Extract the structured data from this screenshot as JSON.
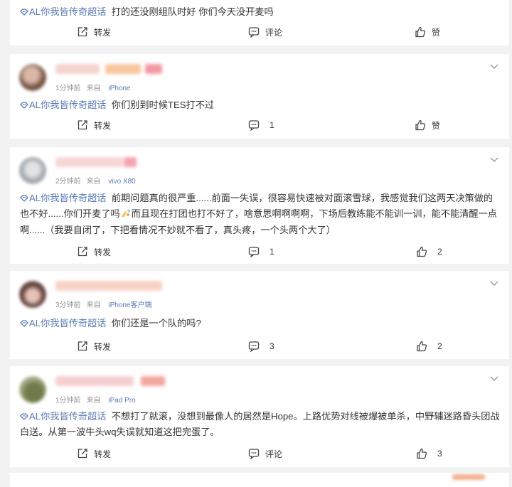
{
  "topic_label": "AL你我皆传奇超话",
  "action_labels": {
    "share": "转发",
    "comment": "评论",
    "like": "赞"
  },
  "posts": [
    {
      "user": {
        "time": "",
        "source_prefix": "",
        "source": ""
      },
      "text": "打的还没刚组队时好 你们今天没开麦吗",
      "actions": {
        "share": "转发",
        "comment": "评论",
        "like": "赞"
      }
    },
    {
      "user": {
        "time": "1分钟前",
        "source_prefix": "来自",
        "source": "iPhone"
      },
      "text": "你们别到时候TES打不过",
      "actions": {
        "share": "转发",
        "comment": "1",
        "like": "赞"
      }
    },
    {
      "user": {
        "time": "2分钟前",
        "source_prefix": "来自",
        "source": "vivo X80"
      },
      "text_before_emoji": "前期问题真的很严重......前面一失误，很容易快速被对面滚雪球，我感觉我们这两天决策做的也不好......你们开麦了吗",
      "emoji": "hand-emoji",
      "text_after_emoji": "而且现在打团也打不好了，啥意思啊啊啊啊，下场后教练能不能训一训，能不能清醒一点啊......（我要自闭了，下把看情况不妙就不看了，真头疼，一个头两个大了）",
      "actions": {
        "share": "转发",
        "comment": "1",
        "like": "2"
      }
    },
    {
      "user": {
        "time": "3分钟前",
        "source_prefix": "来自",
        "source": "iPhone客户端"
      },
      "text": "你们还是一个队的吗?",
      "actions": {
        "share": "转发",
        "comment": "3",
        "like": "2"
      }
    },
    {
      "user": {
        "time": "1分钟前",
        "source_prefix": "来自",
        "source": "iPad Pro"
      },
      "text": "不想打了就滚，没想到最像人的居然是Hope。上路优势对线被爆被单杀，中野辅迷路昏头团战白送。从第一波牛头wq失误就知道这把完蛋了。",
      "actions": {
        "share": "转发",
        "comment": "评论",
        "like": "3"
      }
    }
  ],
  "colors": {
    "topic": "#5b7cb4",
    "background": "#f2f2f2",
    "card": "#ffffff",
    "meta": "#939393"
  }
}
